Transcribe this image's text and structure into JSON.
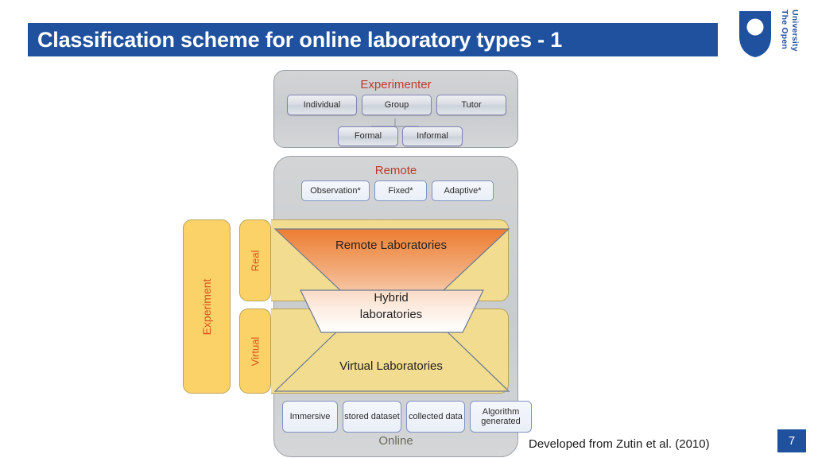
{
  "slide": {
    "title": "Classification scheme for online laboratory types - 1",
    "title_bar_color": "#20519E",
    "credit": "Developed from Zutin et al. (2010)",
    "page_number": "7"
  },
  "logo": {
    "name": "open-university-logo",
    "line1": "The Open",
    "line2": "University",
    "color": "#20519E"
  },
  "diagram": {
    "experimenter": {
      "heading": "Experimenter",
      "heading_color": "#C0392B",
      "boxes": [
        {
          "label": "Individual"
        },
        {
          "label": "Group"
        },
        {
          "label": "Tutor"
        }
      ],
      "sub_boxes": [
        {
          "label": "Formal"
        },
        {
          "label": "Informal"
        }
      ]
    },
    "remote": {
      "heading": "Remote",
      "heading_color": "#C0392B",
      "boxes": [
        {
          "label": "Observation*"
        },
        {
          "label": "Fixed*"
        },
        {
          "label": "Adaptive*"
        }
      ]
    },
    "axis_labels": {
      "experiment": "Experiment",
      "real": "Real",
      "virtual": "Virtual",
      "color": "#D9531E"
    },
    "laboratories": {
      "remote": "Remote Laboratories",
      "hybrid": "Hybrid\nlaboratories",
      "virtual": "Virtual Laboratories"
    },
    "online": {
      "label": "Online",
      "boxes": [
        {
          "label": "Immersive"
        },
        {
          "label": "stored\ndataset"
        },
        {
          "label": "collected\ndata"
        },
        {
          "label": "Algorithm\ngenerated"
        }
      ]
    }
  }
}
